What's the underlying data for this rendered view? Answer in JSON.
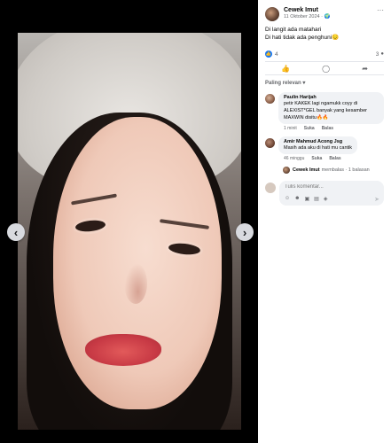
{
  "post": {
    "author": "Cewek Imut",
    "date": "11 Oktober 2024 · 🌍",
    "caption_line1": "Di langit ada matahari",
    "caption_line2": "Di hati tidak ada penghuni😔"
  },
  "reactions": {
    "like_count": "4",
    "comment_count": "3"
  },
  "sort_label": "Paling relevan ▾",
  "comments": [
    {
      "name": "Paulin Harijah",
      "text": "petir KAKEK lagi ngamukk coyy di ALEXIST*GEL banyak yang kesamber MAXWIN disitu🔥🔥",
      "time": "1 minit",
      "like": "Suka",
      "reply": "Balas"
    },
    {
      "name": "Amir Mahmud Acong Jsg",
      "text": "Masih ada aku di hati mu cantik",
      "time": "46 minggu",
      "like": "Suka",
      "reply": "Balas"
    }
  ],
  "replies_link": {
    "name": "Cewek Imut",
    "text": "membalas · 1 balasan"
  },
  "composer": {
    "placeholder": "Tulis komentar..."
  },
  "icons": {
    "nav_prev": "chevron-left-icon",
    "nav_next": "chevron-right-icon",
    "globe": "globe-icon",
    "more": "more-icon",
    "like": "thumbs-up-icon",
    "comment": "comment-icon",
    "share": "share-icon",
    "send": "send-icon"
  },
  "colors": {
    "accent": "#1877f2"
  }
}
